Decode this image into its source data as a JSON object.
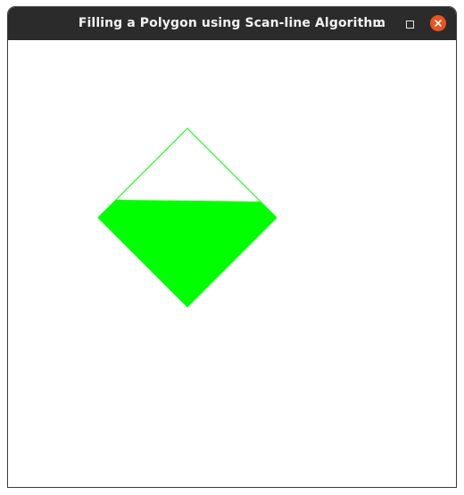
{
  "window": {
    "title": "Filling a Polygon using Scan-line Algorithm"
  },
  "controls": {
    "minimize_icon": "minimize-icon",
    "maximize_icon": "maximize-icon",
    "close_icon": "close-icon",
    "close_color": "#e9541f"
  },
  "canvas": {
    "background": "#ffffff",
    "polygon": {
      "outline_color": "#00ff00",
      "fill_color": "#00ff00",
      "fill_progress_fraction": 0.6
    }
  }
}
